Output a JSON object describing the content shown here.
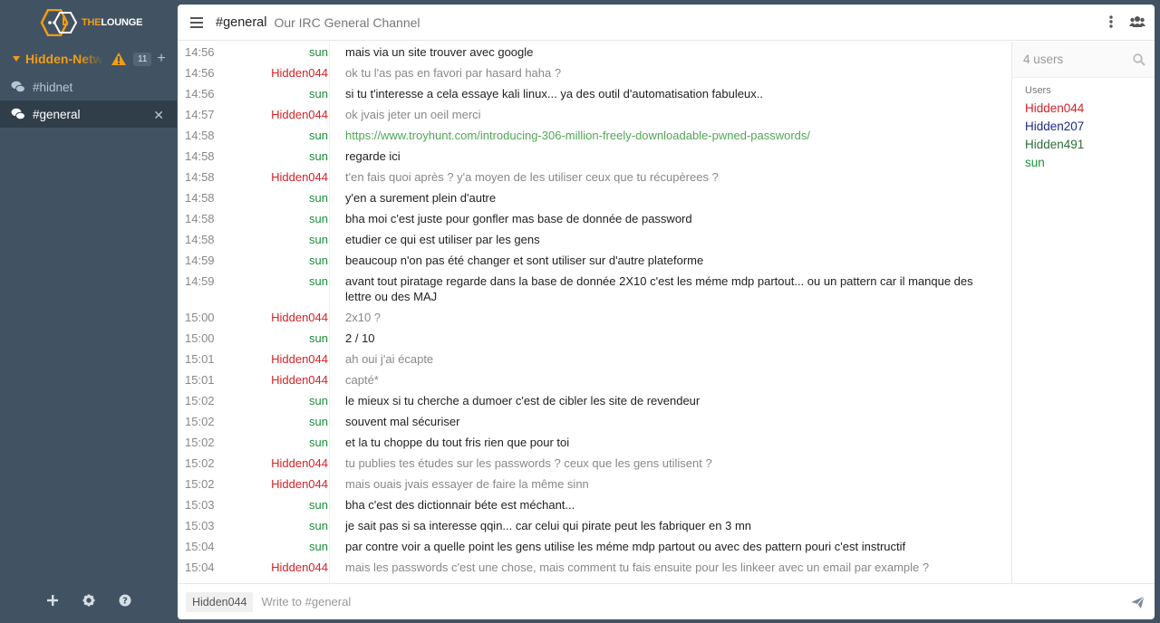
{
  "app": {
    "logo_the": "THE",
    "logo_lounge": "LOUNGE"
  },
  "sidebar": {
    "network": {
      "name": "Hidden-Network",
      "badge": "11"
    },
    "channels": [
      {
        "name": "#hidnet"
      },
      {
        "name": "#general",
        "active": true
      }
    ]
  },
  "header": {
    "channel": "#general",
    "topic": "Our IRC General Channel"
  },
  "colors": {
    "sun": "#1c8f3c",
    "Hidden044": "#d62228",
    "Hidden207": "#1f2a8a",
    "Hidden491": "#2b6d3c",
    "accent": "#f39c12"
  },
  "messages": [
    {
      "time": "14:56",
      "nick": "sun",
      "text": "mais via un site trouver avec google"
    },
    {
      "time": "14:56",
      "nick": "Hidden044",
      "text": "ok tu l'as pas en favori par hasard haha ?"
    },
    {
      "time": "14:56",
      "nick": "sun",
      "text": "si tu t'interesse a cela essaye kali linux... ya des outil d'automatisation fabuleux.."
    },
    {
      "time": "14:57",
      "nick": "Hidden044",
      "text": "ok jvais jeter un oeil merci"
    },
    {
      "time": "14:58",
      "nick": "sun",
      "text": "https://www.troyhunt.com/introducing-306-million-freely-downloadable-pwned-passwords/",
      "link": true
    },
    {
      "time": "14:58",
      "nick": "sun",
      "text": "regarde ici"
    },
    {
      "time": "14:58",
      "nick": "Hidden044",
      "text": "t'en fais quoi après ? y'a moyen de les utiliser ceux que tu récupèrees ?"
    },
    {
      "time": "14:58",
      "nick": "sun",
      "text": "y'en a surement plein d'autre"
    },
    {
      "time": "14:58",
      "nick": "sun",
      "text": "bha moi c'est juste pour gonfler mas base de donnée de password"
    },
    {
      "time": "14:58",
      "nick": "sun",
      "text": "etudier ce qui est utiliser par les gens"
    },
    {
      "time": "14:59",
      "nick": "sun",
      "text": "beaucoup n'on pas été changer et sont utiliser sur d'autre plateforme"
    },
    {
      "time": "14:59",
      "nick": "sun",
      "text": "avant tout piratage regarde dans la base de donnée 2X10 c'est les méme mdp partout... ou un pattern car il manque des lettre ou des MAJ"
    },
    {
      "time": "15:00",
      "nick": "Hidden044",
      "text": "2x10 ?"
    },
    {
      "time": "15:00",
      "nick": "sun",
      "text": "2 / 10"
    },
    {
      "time": "15:01",
      "nick": "Hidden044",
      "text": "ah oui j'ai écapte"
    },
    {
      "time": "15:01",
      "nick": "Hidden044",
      "text": "capté*"
    },
    {
      "time": "15:02",
      "nick": "sun",
      "text": "le mieux si tu cherche a dumoer c'est de cibler les site de revendeur"
    },
    {
      "time": "15:02",
      "nick": "sun",
      "text": "souvent mal sécuriser"
    },
    {
      "time": "15:02",
      "nick": "sun",
      "text": "et la tu choppe du tout fris rien que pour toi"
    },
    {
      "time": "15:02",
      "nick": "Hidden044",
      "text": "tu publies tes études sur les passwords ?  ceux que les gens utilisent ?"
    },
    {
      "time": "15:02",
      "nick": "Hidden044",
      "text": "mais ouais jvais essayer de faire la même sinn"
    },
    {
      "time": "15:03",
      "nick": "sun",
      "text": "bha c'est des dictionnair béte est méchant..."
    },
    {
      "time": "15:03",
      "nick": "sun",
      "text": "je sait pas si sa interesse qqin... car celui qui pirate peut les fabriquer en 3 mn"
    },
    {
      "time": "15:04",
      "nick": "sun",
      "text": "par contre voir a quelle point les gens utilise les méme mdp partout ou avec des pattern pouri c'est instructif"
    },
    {
      "time": "15:04",
      "nick": "Hidden044",
      "text": "mais les passwords c'est une chose, mais comment tu fais ensuite pour les linkeer avec un email par example ?"
    }
  ],
  "userlist": {
    "count": "4 users",
    "heading": "Users",
    "users": [
      {
        "name": "Hidden044",
        "color": "#d62228"
      },
      {
        "name": "Hidden207",
        "color": "#1f2a8a"
      },
      {
        "name": "Hidden491",
        "color": "#2b6d3c"
      },
      {
        "name": "sun",
        "color": "#1c8f3c"
      }
    ]
  },
  "input": {
    "nick": "Hidden044",
    "placeholder": "Write to #general"
  }
}
